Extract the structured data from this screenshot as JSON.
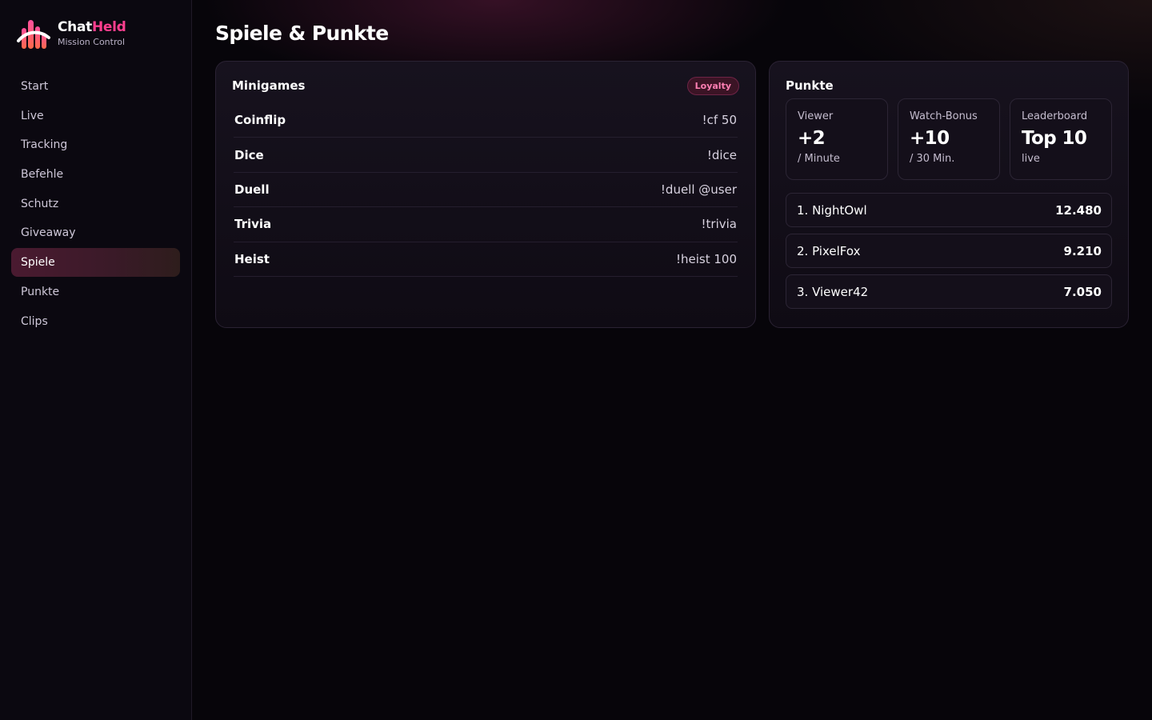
{
  "brand": {
    "name_part1": "Chat",
    "name_part2": "Held",
    "subtitle": "Mission Control",
    "accent_color": "#ff3f8f",
    "logo_icon": "chatheld-logo-icon"
  },
  "sidebar": {
    "items": [
      {
        "label": "Start",
        "active": false
      },
      {
        "label": "Live",
        "active": false
      },
      {
        "label": "Tracking",
        "active": false
      },
      {
        "label": "Befehle",
        "active": false
      },
      {
        "label": "Schutz",
        "active": false
      },
      {
        "label": "Giveaway",
        "active": false
      },
      {
        "label": "Spiele",
        "active": true
      },
      {
        "label": "Punkte",
        "active": false
      },
      {
        "label": "Clips",
        "active": false
      }
    ]
  },
  "page": {
    "title": "Spiele & Punkte"
  },
  "minigames": {
    "title": "Minigames",
    "badge": "Loyalty",
    "rows": [
      {
        "name": "Coinflip",
        "command": "!cf 50"
      },
      {
        "name": "Dice",
        "command": "!dice"
      },
      {
        "name": "Duell",
        "command": "!duell @user"
      },
      {
        "name": "Trivia",
        "command": "!trivia"
      },
      {
        "name": "Heist",
        "command": "!heist 100"
      }
    ]
  },
  "points": {
    "title": "Punkte",
    "stats": [
      {
        "label": "Viewer",
        "value": "+2",
        "sub": "/ Minute"
      },
      {
        "label": "Watch-Bonus",
        "value": "+10",
        "sub": "/ 30 Min."
      },
      {
        "label": "Leaderboard",
        "value": "Top 10",
        "sub": "live"
      }
    ],
    "leaderboard": [
      {
        "name": "1. NightOwl",
        "score": "12.480"
      },
      {
        "name": "2. PixelFox",
        "score": "9.210"
      },
      {
        "name": "3. Viewer42",
        "score": "7.050"
      }
    ]
  }
}
